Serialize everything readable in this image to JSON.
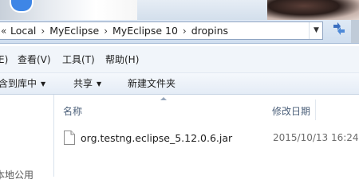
{
  "address_bar": {
    "crumbs": [
      "Local",
      "MyEclipse",
      "MyEclipse 10",
      "dropins"
    ]
  },
  "menu": {
    "items": [
      "E)",
      "查看(V)",
      "工具(T)",
      "帮助(H)"
    ]
  },
  "toolbar": {
    "include_label": "含到库中",
    "share_label": "共享",
    "new_folder_label": "新建文件夹"
  },
  "columns": {
    "name": "名称",
    "modified": "修改日期"
  },
  "files": [
    {
      "name": "org.testng.eclipse_5.12.0.6.jar",
      "modified": "2015/10/13 16:24"
    }
  ],
  "nav": {
    "bottom_text": "本地公用"
  },
  "colors": {
    "accent_blue": "#3e86e6",
    "column_header_text": "#4c607a"
  }
}
